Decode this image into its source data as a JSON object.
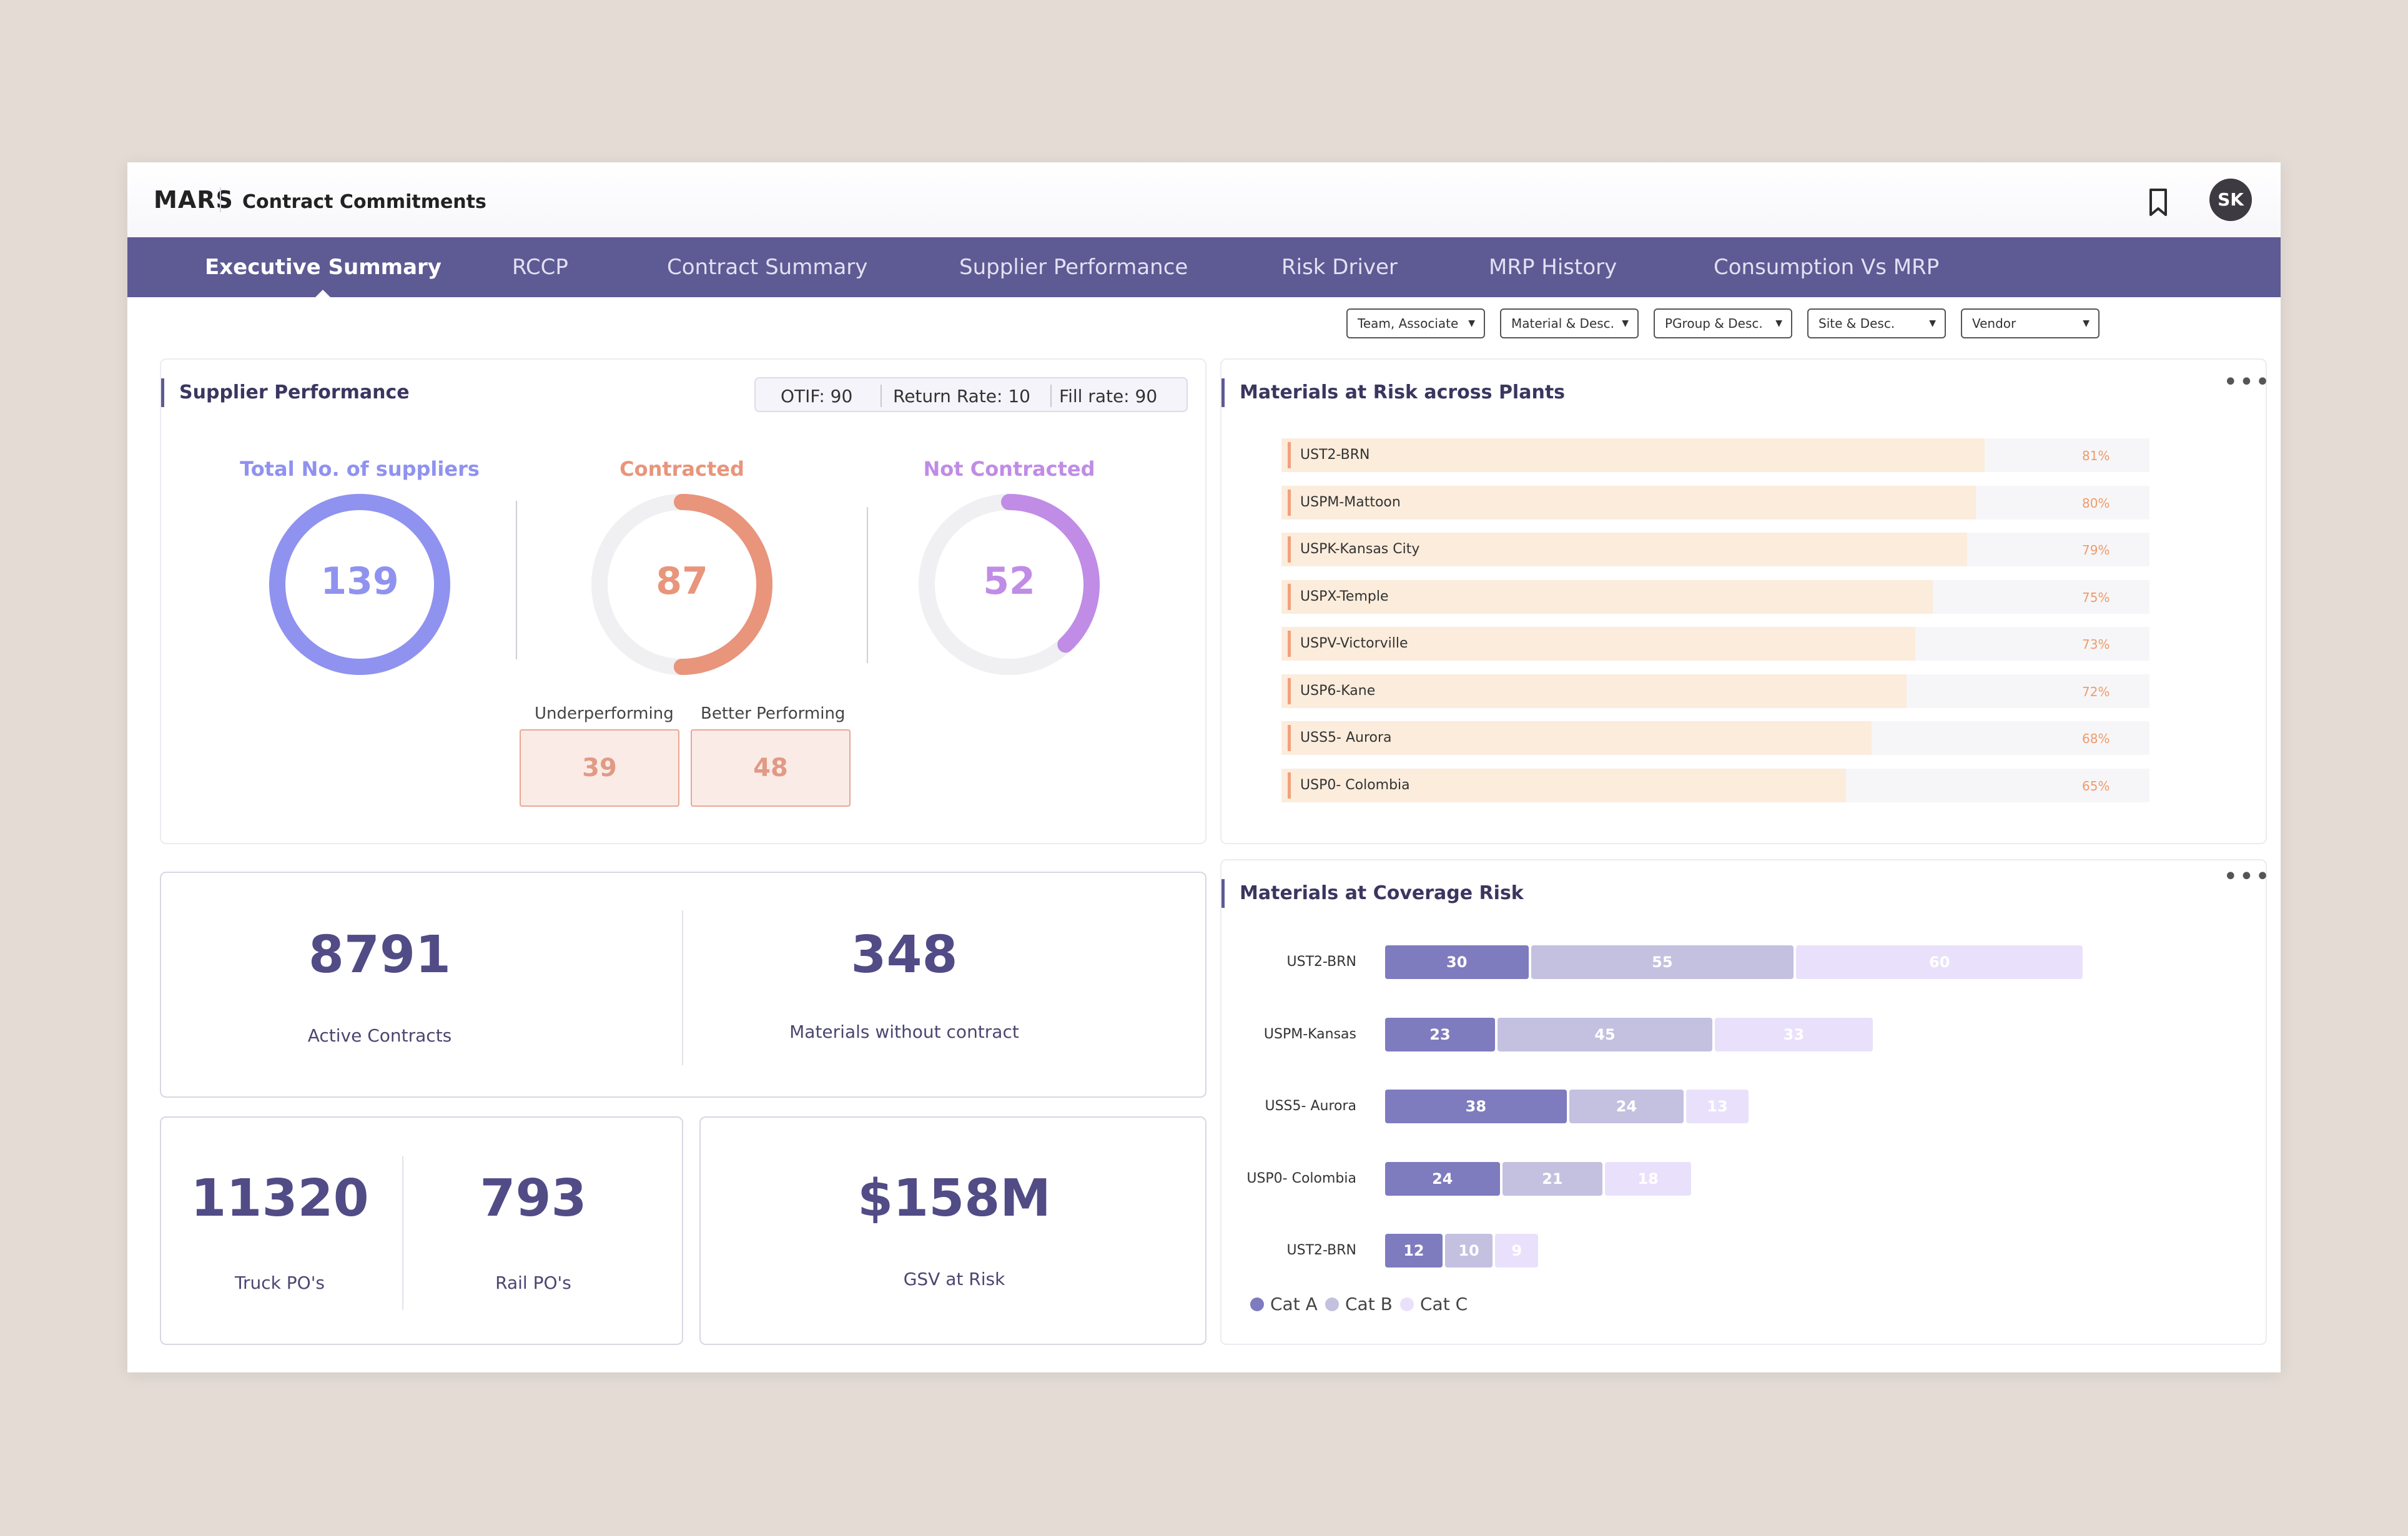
{
  "header": {
    "brand": "MARS",
    "title": "Contract Commitments",
    "avatar_initials": "SK"
  },
  "nav": {
    "tabs": [
      {
        "label": "Executive Summary",
        "active": true
      },
      {
        "label": "RCCP"
      },
      {
        "label": "Contract Summary"
      },
      {
        "label": "Supplier Performance"
      },
      {
        "label": "Risk Driver"
      },
      {
        "label": "MRP History"
      },
      {
        "label": "Consumption Vs MRP"
      }
    ]
  },
  "filters": [
    "Team, Associate",
    "Material & Desc.",
    "PGroup & Desc.",
    "Site & Desc.",
    "Vendor"
  ],
  "supplier_performance": {
    "title": "Supplier Performance",
    "otif": "OTIF: 90",
    "return_rate": "Return Rate: 10",
    "fill_rate": "Fill rate: 90",
    "total": {
      "label": "Total No. of suppliers",
      "value": "139",
      "color": "#8f92ef"
    },
    "contracted": {
      "label": "Contracted",
      "value": "87",
      "fraction": 0.5,
      "color": "#e8957c"
    },
    "not_contracted": {
      "label": "Not Contracted",
      "value": "52",
      "fraction": 0.38,
      "color": "#c08ce6"
    },
    "underperforming": {
      "label": "Underperforming",
      "value": "39"
    },
    "better_performing": {
      "label": "Better Performing",
      "value": "48"
    }
  },
  "materials_risk": {
    "title": "Materials at Risk across Plants",
    "rows": [
      {
        "name": "UST2-BRN",
        "pct": "81%",
        "value": 81
      },
      {
        "name": "USPM-Mattoon",
        "pct": "80%",
        "value": 80
      },
      {
        "name": "USPK-Kansas City",
        "pct": "79%",
        "value": 79
      },
      {
        "name": "USPX-Temple",
        "pct": "75%",
        "value": 75
      },
      {
        "name": "USPV-Victorville",
        "pct": "73%",
        "value": 73
      },
      {
        "name": "USP6-Kane",
        "pct": "72%",
        "value": 72
      },
      {
        "name": "USS5- Aurora",
        "pct": "68%",
        "value": 68
      },
      {
        "name": "USP0- Colombia",
        "pct": "65%",
        "value": 65
      }
    ]
  },
  "contracts": {
    "active": {
      "value": "8791",
      "label": "Active Contracts"
    },
    "without": {
      "value": "348",
      "label": "Materials without contract"
    }
  },
  "pos": {
    "truck": {
      "value": "11320",
      "label": "Truck PO's"
    },
    "rail": {
      "value": "793",
      "label": "Rail PO's"
    }
  },
  "gsv": {
    "value": "$158M",
    "label": "GSV at Risk"
  },
  "coverage_risk": {
    "title": "Materials at Coverage Risk",
    "chart_data": {
      "type": "bar",
      "categories": [
        "UST2-BRN",
        "USPM-Kansas",
        "USS5- Aurora",
        "USP0- Colombia",
        "UST2-BRN"
      ],
      "series": [
        {
          "name": "Cat A",
          "values": [
            30,
            23,
            38,
            24,
            12
          ],
          "color": "#7f7bbf"
        },
        {
          "name": "Cat B",
          "values": [
            55,
            45,
            24,
            21,
            10
          ],
          "color": "#c4c0e0"
        },
        {
          "name": "Cat C",
          "values": [
            60,
            33,
            13,
            18,
            9
          ],
          "color": "#e9e1fb"
        }
      ]
    }
  }
}
